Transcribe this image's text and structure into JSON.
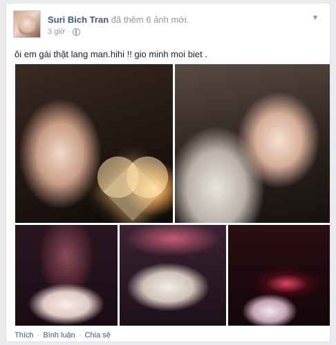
{
  "post": {
    "author": "Suri Bich Tran",
    "action_text": "đã thêm 6 ảnh mới.",
    "time": "3 giờ ·",
    "body": "ôi em gái thật lang man.hihi !! gio minh moi biet ."
  },
  "icons": {
    "menu": "chevron-down-icon",
    "privacy": "globe-icon"
  },
  "actions": {
    "like": "Thích",
    "comment": "Bình luận",
    "share": "Chia sẻ",
    "separator": "·"
  },
  "colors": {
    "link": "#365899",
    "meta": "#90949c",
    "text": "#1d2129",
    "background": "#e9ebee"
  }
}
